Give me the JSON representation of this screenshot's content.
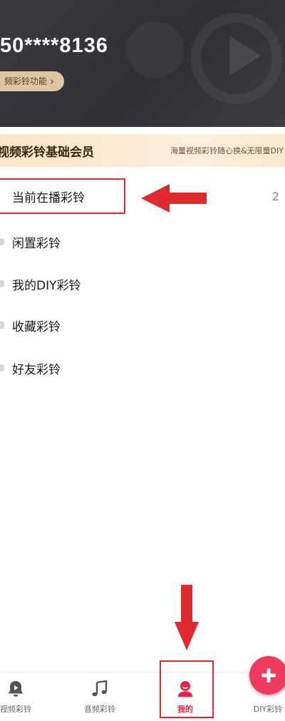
{
  "header": {
    "phone": "50****8136",
    "feature_link": "频彩铃功能",
    "chevron": "›"
  },
  "member_banner": {
    "title": "视频彩铃基础会员",
    "subtitle": "海量视频彩铃随心换&无限量DIY"
  },
  "menu": {
    "items": [
      {
        "label": "当前在播彩铃",
        "count": "2"
      },
      {
        "label": "闲置彩铃"
      },
      {
        "label": "我的DIY彩铃"
      },
      {
        "label": "收藏彩铃"
      },
      {
        "label": "好友彩铃"
      }
    ]
  },
  "bottom_nav": {
    "items": [
      {
        "label": "视频彩铃",
        "icon": "bell-play-icon"
      },
      {
        "label": "音频彩铃",
        "icon": "music-note-icon"
      },
      {
        "label": "我的",
        "icon": "user-icon",
        "active": true
      },
      {
        "label": "DIY彩铃",
        "icon": "plus-icon"
      }
    ]
  },
  "colors": {
    "accent": "#e8234a",
    "annotation_red": "#e12a2f",
    "header_bg": "#34353a",
    "member_gold": "#fae4c6"
  }
}
